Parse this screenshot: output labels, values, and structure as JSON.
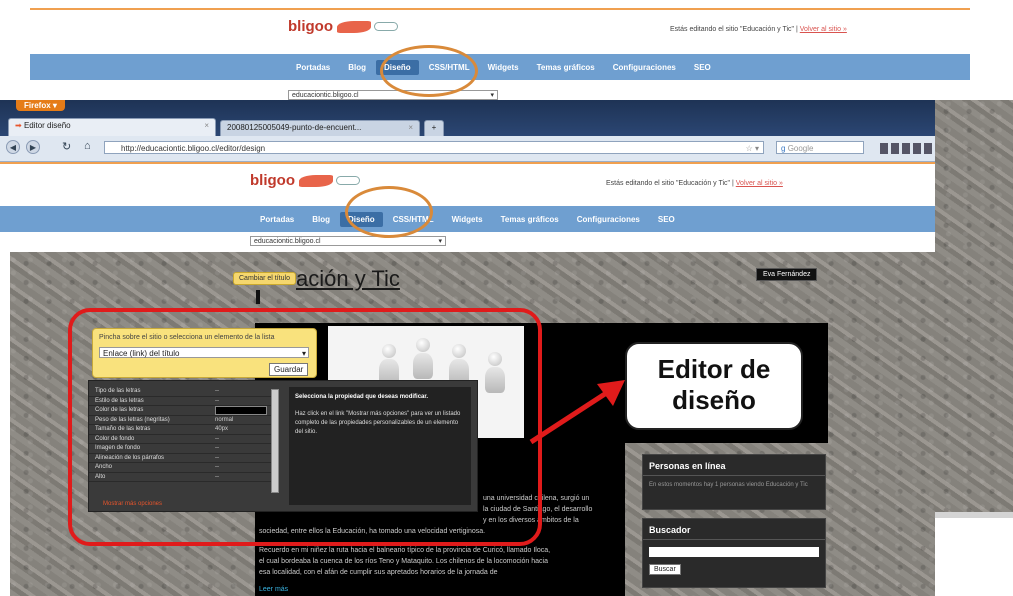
{
  "top_screenshot": {
    "logo_main": "bligoo",
    "edit_notice": "Estás editando el sitio \"Educación y Tic\" |",
    "edit_link": "Volver al sitio »",
    "nav": [
      "Portadas",
      "Blog",
      "Diseño",
      "CSS/HTML",
      "Widgets",
      "Temas gráficos",
      "Configuraciones",
      "SEO"
    ],
    "site_select": "educaciontic.bligoo.cl"
  },
  "browser": {
    "firefox_label": "Firefox",
    "tab1": "Editor diseño",
    "tab2": "20080125005049-punto-de-encuent...",
    "url": "http://educaciontic.bligoo.cl/editor/design",
    "search_placeholder": "Google"
  },
  "editor_header": {
    "logo_main": "bligoo",
    "edit_notice": "Estás editando el sitio \"Educación y Tic\" |",
    "edit_link": "Volver al sitio »",
    "nav": [
      "Portadas",
      "Blog",
      "Diseño",
      "CSS/HTML",
      "Widgets",
      "Temas gráficos",
      "Configuraciones",
      "SEO"
    ],
    "site_select": "educaciontic.bligoo.cl"
  },
  "blog": {
    "change_title_btn": "Cambiar el título",
    "title_visible": "ación y Tic",
    "user_chip": "Eva Fernández",
    "sidebar_people_title": "Personas en línea",
    "sidebar_people_text": "En estos momentos hay 1 personas viendo Educación y Tic",
    "sidebar_search_title": "Buscador",
    "search_button": "Buscar",
    "body_lines": [
      "una universidad chilena, surgió un",
      "la ciudad de Santiago, el desarrollo",
      "y en los diversos ámbitos de la",
      "sociedad, entre ellos la Educación, ha tomado una velocidad vertiginosa.",
      "Recuerdo en mi niñez la ruta hacia el balneario típico de la provincia de Curicó, llamado Iloca,",
      "el cual bordeaba la cuenca de los ríos Teno y Mataquito. Los chilenos de la locomoción hacia",
      "esa localidad, con el afán de cumplir sus apretados horarios de la jornada de"
    ],
    "read_more": "Leer más"
  },
  "editor_panel": {
    "instruction": "Pincha sobre el sitio o selecciona un elemento de la lista",
    "selected_element": "Enlace (link) del título",
    "save_button": "Guardar",
    "properties": [
      {
        "name": "Tipo de las letras",
        "value": "--"
      },
      {
        "name": "Estilo de las letras",
        "value": "--"
      },
      {
        "name": "Color de las letras",
        "value": ""
      },
      {
        "name": "Peso de las letras (negritas)",
        "value": "normal"
      },
      {
        "name": "Tamaño de las letras",
        "value": "40px"
      },
      {
        "name": "Color de fondo",
        "value": "--"
      },
      {
        "name": "Imagen de fondo",
        "value": "--"
      },
      {
        "name": "Alineación de los párrafos",
        "value": "--"
      },
      {
        "name": "Ancho",
        "value": "--"
      },
      {
        "name": "Alto",
        "value": "--"
      }
    ],
    "more_options": "Mostrar más opciones",
    "help_title": "Selecciona la propiedad que deseas modificar.",
    "help_text": "Haz click en el link \"Mostrar más opciones\" para ver un listado completo de las propiedades personalizables de un elemento del sitio."
  },
  "annotation": {
    "callout_line1": "Editor de",
    "callout_line2": "diseño",
    "ellipse_color": "#d98a3a",
    "highlight_color": "#e01b1b"
  }
}
